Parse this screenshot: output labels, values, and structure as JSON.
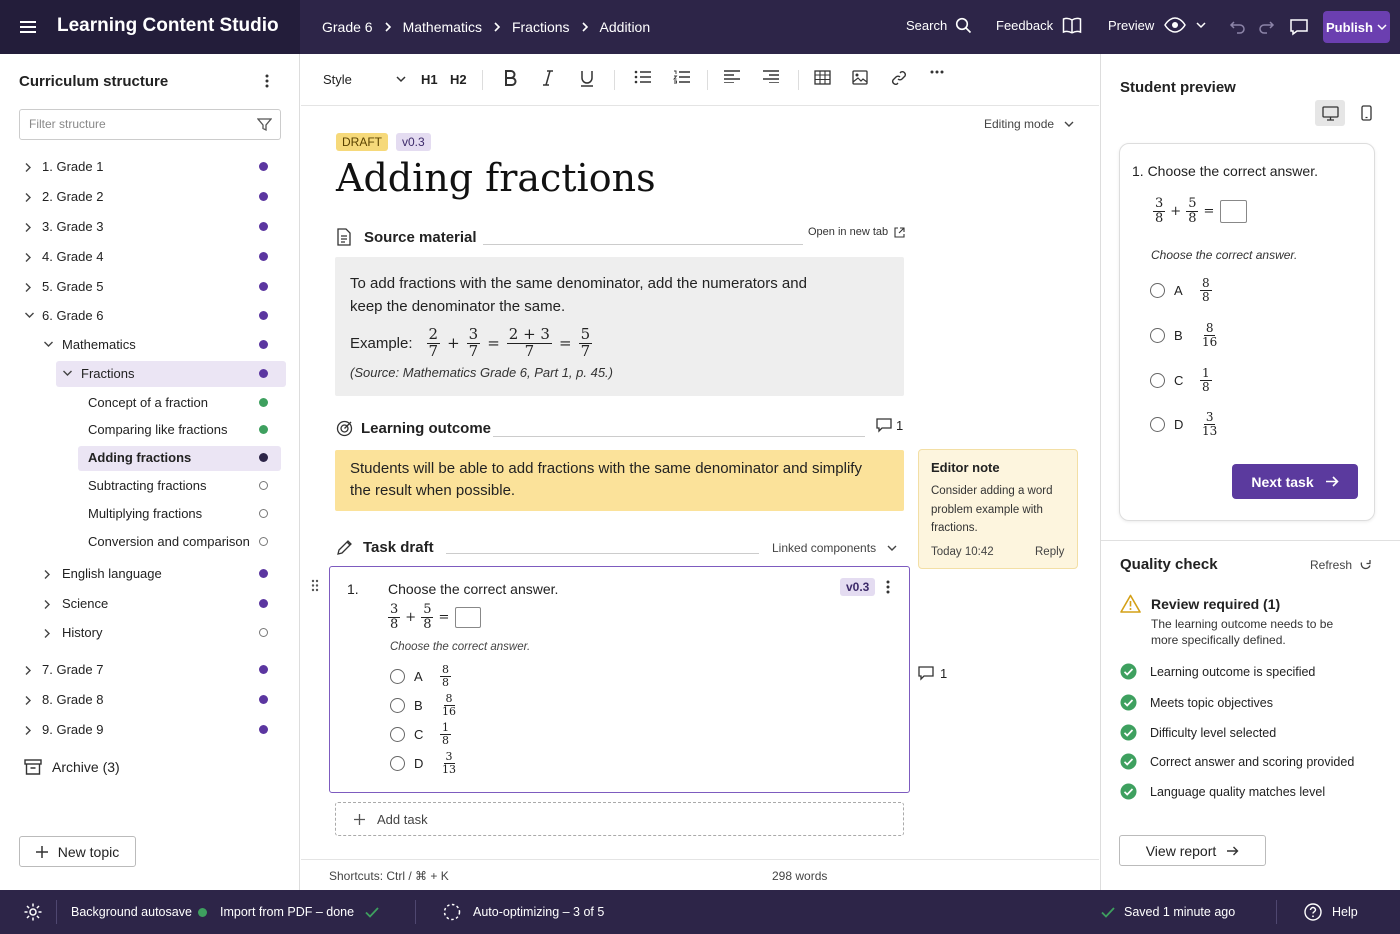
{
  "app": {
    "title": "Learning Content Studio"
  },
  "breadcrumb": [
    "Grade 6",
    "Mathematics",
    "Fractions",
    "Addition"
  ],
  "topbar": {
    "search": "Search",
    "feedback": "Feedback",
    "preview": "Preview",
    "publish": "Publish"
  },
  "sidebar": {
    "title": "Curriculum structure",
    "filter_placeholder": "Filter structure",
    "tree": [
      {
        "label": "1. Grade 1",
        "status": "purple"
      },
      {
        "label": "2. Grade 2",
        "status": "purple"
      },
      {
        "label": "3. Grade 3",
        "status": "purple"
      },
      {
        "label": "4. Grade 4",
        "status": "purple"
      },
      {
        "label": "5. Grade 5",
        "status": "purple"
      },
      {
        "label": "6. Grade 6",
        "status": "purple"
      },
      {
        "label": "Mathematics",
        "status": "purple"
      },
      {
        "label": "Fractions",
        "status": "purple"
      },
      {
        "label": "Concept of a fraction",
        "status": "green"
      },
      {
        "label": "Comparing like fractions",
        "status": "green"
      },
      {
        "label": "Adding fractions",
        "status": "dark"
      },
      {
        "label": "Subtracting fractions",
        "status": "empty"
      },
      {
        "label": "Multiplying fractions",
        "status": "empty"
      },
      {
        "label": "Conversion and comparison",
        "status": "empty"
      },
      {
        "label": "English language",
        "status": "purple"
      },
      {
        "label": "Science",
        "status": "purple"
      },
      {
        "label": "History",
        "status": "empty"
      },
      {
        "label": "7. Grade 7",
        "status": "purple"
      },
      {
        "label": "8. Grade 8",
        "status": "purple"
      },
      {
        "label": "9. Grade 9",
        "status": "purple"
      }
    ],
    "archive": "Archive (3)",
    "new_topic": "New topic"
  },
  "toolbar": {
    "style": "Style",
    "h1": "H1",
    "h2": "H2"
  },
  "editor": {
    "editing_mode": "Editing mode",
    "badge_draft": "DRAFT",
    "badge_version": "v0.3",
    "title": "Adding fractions",
    "source": {
      "heading": "Source material",
      "open_new_tab": "Open in new tab",
      "text": "To add fractions with the same denominator, add the numerators and keep the denominator the same.",
      "example_label": "Example:",
      "citation": "(Source: Mathematics Grade 6, Part 1, p. 45.)"
    },
    "outcome": {
      "heading": "Learning outcome",
      "comments": "1",
      "text": "Students will be able to add fractions with the same denominator and simplify the result when possible."
    },
    "note": {
      "title": "Editor note",
      "text": "Consider adding a word problem example with fractions.",
      "time": "Today 10:42",
      "reply": "Reply"
    },
    "task": {
      "heading": "Task draft",
      "linked": "Linked components",
      "number": "1.",
      "question": "Choose the correct answer.",
      "version": "v0.3",
      "instruction": "Choose the correct answer.",
      "options": [
        {
          "letter": "A",
          "num": "8",
          "den": "8"
        },
        {
          "letter": "B",
          "num": "8",
          "den": "16"
        },
        {
          "letter": "C",
          "num": "1",
          "den": "8"
        },
        {
          "letter": "D",
          "num": "3",
          "den": "13"
        }
      ],
      "comments": "1"
    },
    "add_task": "Add task",
    "shortcuts": "Shortcuts:  Ctrl / ⌘ + K",
    "word_count": "298 words"
  },
  "preview": {
    "title": "Student preview",
    "question": "1.  Choose the correct answer.",
    "instruction": "Choose the correct answer.",
    "next_task": "Next task"
  },
  "quality": {
    "title": "Quality check",
    "refresh": "Refresh",
    "review_title": "Review required (1)",
    "review_text": "The learning outcome needs to be more specifically defined.",
    "checks": [
      "Learning outcome is specified",
      "Meets topic objectives",
      "Difficulty level selected",
      "Correct answer and scoring provided",
      "Language quality matches level"
    ],
    "view_report": "View report"
  },
  "statusbar": {
    "autosave": "Background autosave",
    "import": "Import from PDF – done",
    "optimizing": "Auto-optimizing – 3 of 5",
    "saved": "Saved 1 minute ago",
    "help": "Help"
  },
  "colors": {
    "header": "#2d2548",
    "accent": "#5b3a9e",
    "draft": "#f6d97a",
    "outcome": "#fbe29a",
    "ok": "#3ea05f"
  }
}
